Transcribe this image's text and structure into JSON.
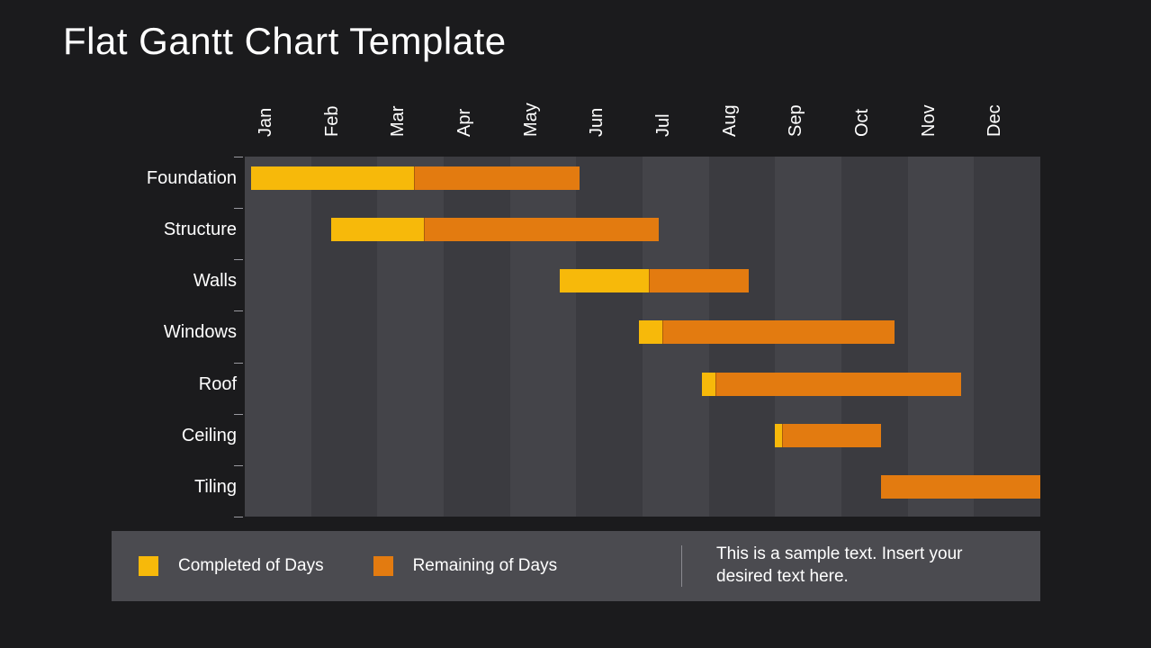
{
  "title": "Flat Gantt Chart Template",
  "legend": {
    "completed": "Completed of Days",
    "remaining": "Remaining of Days"
  },
  "caption": "This is a sample text. Insert your desired text here.",
  "colors": {
    "completed": "#f7b90a",
    "remaining": "#e37b10"
  },
  "chart_data": {
    "type": "gantt",
    "title": "Flat Gantt Chart Template",
    "x_categories": [
      "Jan",
      "Feb",
      "Mar",
      "Apr",
      "May",
      "Jun",
      "Jul",
      "Aug",
      "Sep",
      "Oct",
      "Nov",
      "Dec"
    ],
    "x_range_months": [
      0,
      12
    ],
    "tasks": [
      {
        "name": "Foundation",
        "start": 0.1,
        "end": 5.05,
        "completed_end": 2.55
      },
      {
        "name": "Structure",
        "start": 1.3,
        "end": 6.25,
        "completed_end": 2.7
      },
      {
        "name": "Walls",
        "start": 4.75,
        "end": 7.6,
        "completed_end": 6.1
      },
      {
        "name": "Windows",
        "start": 5.95,
        "end": 9.8,
        "completed_end": 6.3
      },
      {
        "name": "Roof",
        "start": 6.9,
        "end": 10.8,
        "completed_end": 7.1
      },
      {
        "name": "Ceiling",
        "start": 8.0,
        "end": 9.6,
        "completed_end": 8.1
      },
      {
        "name": "Tiling",
        "start": 9.6,
        "end": 12.0,
        "completed_end": 9.6
      }
    ],
    "legend": [
      "Completed of Days",
      "Remaining of Days"
    ]
  }
}
